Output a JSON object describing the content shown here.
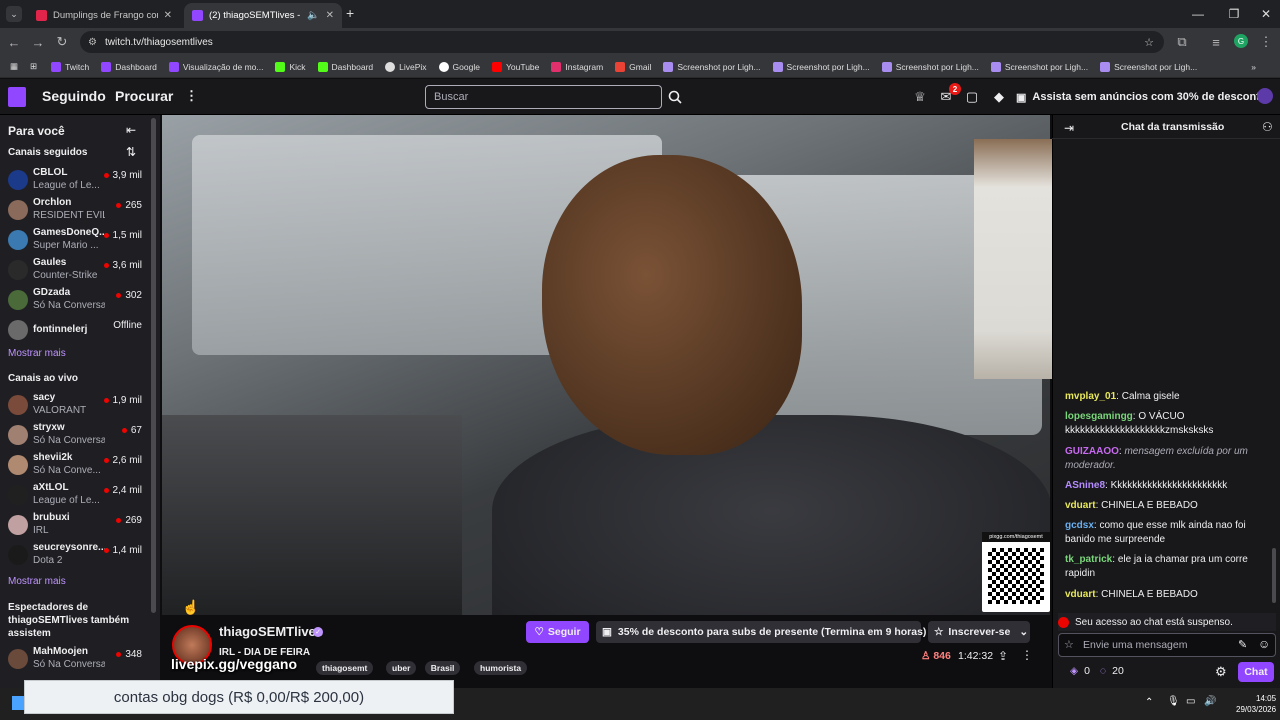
{
  "browser": {
    "tabs": [
      {
        "title": "Dumplings de Frango com BBQ",
        "active": false
      },
      {
        "title": "(2) thiagoSEMTlives - Twitch",
        "active": true
      }
    ],
    "url": "twitch.tv/thiagosemtlives",
    "bookmarks": [
      "Twitch",
      "Dashboard",
      "Visualização de mo...",
      "Kick",
      "Dashboard",
      "LivePix",
      "Google",
      "YouTube",
      "Instagram",
      "Gmail",
      "Screenshot por Ligh...",
      "Screenshot por Ligh...",
      "Screenshot por Ligh...",
      "Screenshot por Ligh...",
      "Screenshot por Ligh..."
    ],
    "profile_initial": "G"
  },
  "nav": {
    "following": "Seguindo",
    "browse": "Procurar",
    "search_placeholder": "Buscar",
    "notif_count": "2",
    "prime_text": "Assista sem anúncios com 30% de desconto"
  },
  "sidebar": {
    "title": "Para você",
    "followed_title": "Canais seguidos",
    "followed": [
      {
        "name": "CBLOL",
        "game": "League of Le...",
        "viewers": "3,9 mil",
        "color": "#1b3a8a"
      },
      {
        "name": "Orchlon",
        "game": "RESIDENT EVIL...",
        "viewers": "265",
        "color": "#8a6a5a"
      },
      {
        "name": "GamesDoneQ...",
        "game": "Super Mario ...",
        "viewers": "1,5 mil",
        "color": "#3a7ab0"
      },
      {
        "name": "Gaules",
        "game": "Counter-Strike",
        "viewers": "3,6 mil",
        "color": "#2a2a2a"
      },
      {
        "name": "GDzada",
        "game": "Só Na Conversa",
        "viewers": "302",
        "color": "#4a6a3a"
      },
      {
        "name": "fontinnelerj",
        "game": "",
        "viewers": "Offline",
        "color": "#6a6a6a"
      }
    ],
    "show_more_1": "Mostrar mais",
    "live_title": "Canais ao vivo",
    "live": [
      {
        "name": "sacy",
        "game": "VALORANT",
        "viewers": "1,9 mil",
        "color": "#7a4a3a"
      },
      {
        "name": "stryxw",
        "game": "Só Na Conversa",
        "viewers": "67",
        "color": "#a08070"
      },
      {
        "name": "shevii2k",
        "game": "Só Na Conve...",
        "viewers": "2,6 mil",
        "color": "#b08a70"
      },
      {
        "name": "aXtLOL",
        "game": "League of Le...",
        "viewers": "2,4 mil",
        "color": "#202020"
      },
      {
        "name": "brubuxi",
        "game": "IRL",
        "viewers": "269",
        "color": "#c0a0a0"
      },
      {
        "name": "seucreysonre...",
        "game": "Dota 2",
        "viewers": "1,4 mil",
        "color": "#1a1a1a"
      }
    ],
    "show_more_2": "Mostrar mais",
    "also_watch_title": "Espectadores de thiagoSEMTlives também assistem",
    "also_watch": [
      {
        "name": "MahMoojen",
        "game": "Só Na Conversa",
        "viewers": "348",
        "color": "#6a4a3a"
      }
    ]
  },
  "stream": {
    "channel": "thiagoSEMTlives",
    "title": "IRL - DIA DE FEIRA",
    "overlay_url": "livepix.gg/veggano",
    "tags": [
      "thiagosemt",
      "uber",
      "Brasil",
      "humorista"
    ],
    "follow_label": "Seguir",
    "promo_label": "35% de desconto para subs de presente (Termina em 9 horas)",
    "subscribe_label": "Inscrever-se",
    "viewers": "846",
    "uptime": "1:42:32",
    "qr_label": "pixgg.com/thiagosemt"
  },
  "chat": {
    "title": "Chat da transmissão",
    "messages": [
      {
        "user": "mvplay_01",
        "text": "Calma gisele",
        "color": "#e8e85a",
        "italic": false
      },
      {
        "user": "lopesgamingg",
        "text": "O VÁCUO kkkkkkkkkkkkkkkkkkkkzmsksksks",
        "color": "#7ad67a",
        "italic": false
      },
      {
        "user": "GUIZAAOO",
        "text": "mensagem excluída por um moderador.",
        "color": "#c86af0",
        "italic": true
      },
      {
        "user": "ASnine8",
        "text": "Kkkkkkkkkkkkkkkkkkkkkkk",
        "color": "#b48cff",
        "italic": false
      },
      {
        "user": "vduart",
        "text": "CHINELA E BEBADO",
        "color": "#e8e85a",
        "italic": false
      },
      {
        "user": "gcdsx",
        "text": "como que esse mlk ainda nao foi banido me surpreende",
        "color": "#6ab0f0",
        "italic": false
      },
      {
        "user": "tk_patrick",
        "text": "ele ja ia chamar pra um corre rapidin",
        "color": "#7ad67a",
        "italic": false
      },
      {
        "user": "vduart",
        "text": "CHINELA E BEBADO",
        "color": "#e8e85a",
        "italic": false
      }
    ],
    "suspended": "Seu acesso ao chat está suspenso.",
    "input_placeholder": "Envie uma mensagem",
    "points": "0",
    "bits": "20",
    "chat_button": "Chat"
  },
  "overlay": {
    "donation_text": "contas obg dogs (R$ 0,00/R$ 200,00)"
  },
  "taskbar": {
    "time": "14:05",
    "date": "29/03/2026"
  }
}
